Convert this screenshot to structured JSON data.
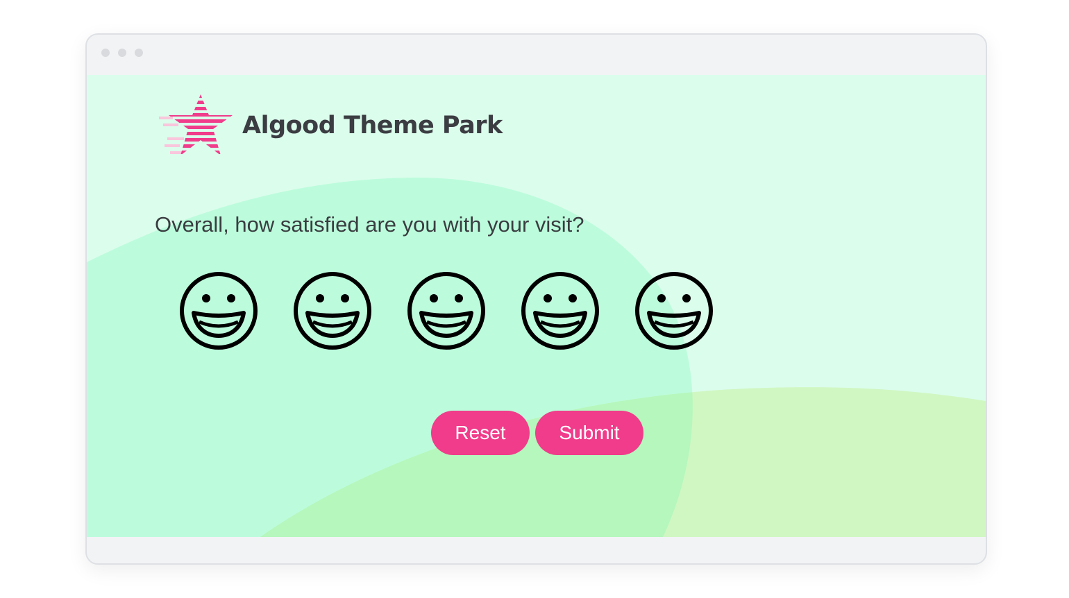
{
  "app": {
    "name": "Algood Theme Park",
    "logo_icon": "striped-star-icon",
    "brand_color": "#f03c8a"
  },
  "survey": {
    "question": "Overall, how satisfied are you with your visit?",
    "options": [
      {
        "icon": "smiley-face-icon"
      },
      {
        "icon": "smiley-face-icon"
      },
      {
        "icon": "smiley-face-icon"
      },
      {
        "icon": "smiley-face-icon"
      },
      {
        "icon": "smiley-face-icon"
      }
    ]
  },
  "actions": {
    "reset_label": "Reset",
    "submit_label": "Submit"
  },
  "colors": {
    "page_background": "#dbfdec",
    "blob_mint": "#bcfcdc",
    "blob_lime": "#d0f7c2",
    "blob_overlap": "#b5f7bd",
    "button": "#f03c8a",
    "window_chrome": "#f2f3f5"
  }
}
